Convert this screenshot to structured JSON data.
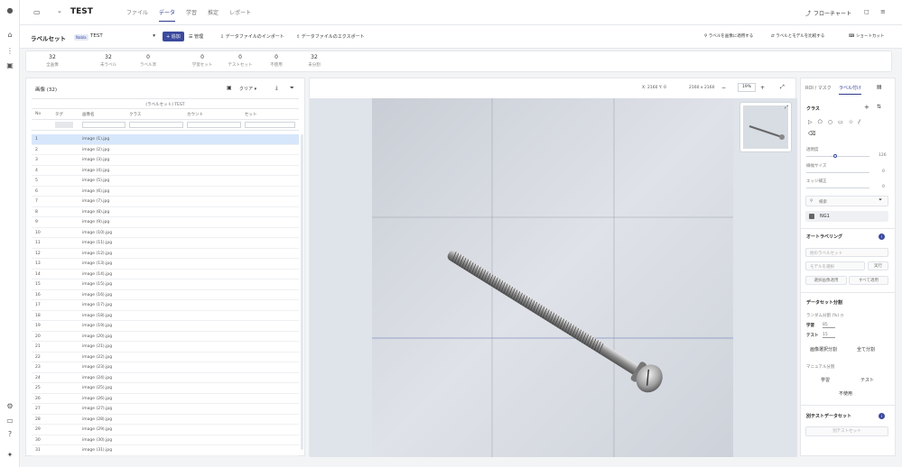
{
  "header": {
    "title": "TEST",
    "tabs": [
      {
        "label": "ファイル",
        "active": false
      },
      {
        "label": "データ",
        "active": true
      },
      {
        "label": "学習",
        "active": false
      },
      {
        "label": "推定",
        "active": false
      },
      {
        "label": "レポート",
        "active": false
      }
    ],
    "flowchart_label": "フローチャート"
  },
  "toolbar": {
    "labelset_label": "ラベルセット",
    "badge": "Nabla",
    "labelset_value": "TEST",
    "add_label": "+ 追加",
    "manage_label": "管理",
    "import_label": "データファイルのインポート",
    "export_label": "データファイルのエクスポート",
    "auto_label": "ラベルを画像に適用する",
    "compare_label": "ラベルとモデルを比較する",
    "shortcut_label": "ショートカット"
  },
  "stats": [
    {
      "value": "32",
      "label": "全画像"
    },
    {
      "value": "32",
      "label": "未ラベル"
    },
    {
      "value": "0",
      "label": "ラベル済"
    },
    {
      "value": "0",
      "label": "学習セット"
    },
    {
      "value": "0",
      "label": "テストセット"
    },
    {
      "value": "0",
      "label": "不使用"
    },
    {
      "value": "32",
      "label": "未分割"
    }
  ],
  "list": {
    "header": "画像 (32)",
    "clear_label": "クリア",
    "group_header": "(ラベルセット) TEST",
    "columns": [
      "No",
      "タグ",
      "画像名",
      "クラス",
      "カウント",
      "セット"
    ],
    "rows": [
      {
        "no": "1",
        "name": "image (1).jpg"
      },
      {
        "no": "2",
        "name": "image (2).jpg"
      },
      {
        "no": "3",
        "name": "image (3).jpg"
      },
      {
        "no": "4",
        "name": "image (4).jpg"
      },
      {
        "no": "5",
        "name": "image (5).jpg"
      },
      {
        "no": "6",
        "name": "image (6).jpg"
      },
      {
        "no": "7",
        "name": "image (7).jpg"
      },
      {
        "no": "8",
        "name": "image (8).jpg"
      },
      {
        "no": "9",
        "name": "image (9).jpg"
      },
      {
        "no": "10",
        "name": "image (10).jpg"
      },
      {
        "no": "11",
        "name": "image (11).jpg"
      },
      {
        "no": "12",
        "name": "image (12).jpg"
      },
      {
        "no": "13",
        "name": "image (13).jpg"
      },
      {
        "no": "14",
        "name": "image (14).jpg"
      },
      {
        "no": "15",
        "name": "image (15).jpg"
      },
      {
        "no": "16",
        "name": "image (16).jpg"
      },
      {
        "no": "17",
        "name": "image (17).jpg"
      },
      {
        "no": "18",
        "name": "image (18).jpg"
      },
      {
        "no": "19",
        "name": "image (19).jpg"
      },
      {
        "no": "20",
        "name": "image (20).jpg"
      },
      {
        "no": "21",
        "name": "image (21).jpg"
      },
      {
        "no": "22",
        "name": "image (22).jpg"
      },
      {
        "no": "23",
        "name": "image (23).jpg"
      },
      {
        "no": "24",
        "name": "image (24).jpg"
      },
      {
        "no": "25",
        "name": "image (25).jpg"
      },
      {
        "no": "26",
        "name": "image (26).jpg"
      },
      {
        "no": "27",
        "name": "image (27).jpg"
      },
      {
        "no": "28",
        "name": "image (28).jpg"
      },
      {
        "no": "29",
        "name": "image (29).jpg"
      },
      {
        "no": "30",
        "name": "image (30).jpg"
      },
      {
        "no": "31",
        "name": "image (31).jpg"
      }
    ]
  },
  "viewer": {
    "coords": "X: 2160  Y: 0",
    "size": "2160 x 2160",
    "zoom": "19%"
  },
  "right": {
    "tab_roi": "ROI / マスク",
    "tab_label": "ラベル付け",
    "class_title": "クラス",
    "opacity_label": "透明度",
    "opacity_value": "126",
    "brush_label": "線幅サイズ",
    "brush_value": "0",
    "edge_label": "エッジ補正",
    "edge_value": "0",
    "search_placeholder": "検索",
    "class_name": "NG1",
    "auto_title": "オートラベリング",
    "auto_select": "他のラベルセット",
    "auto_input": "モデルを選択",
    "auto_exec": "実行",
    "auto_btn1": "選択画像適用",
    "auto_btn2": "すべて適用",
    "split_title": "データセット分割",
    "split_random": "ランダム分割 (%)",
    "train_label": "学習",
    "train_value": "85",
    "test_label": "テスト",
    "test_value": "15",
    "split_btn1": "画像選択分割",
    "split_btn2": "全て分割",
    "manual_label": "マニュアル分割",
    "manual_train": "学習",
    "manual_test": "テスト",
    "manual_unused": "不使用",
    "testdata_title": "別テストデータセット",
    "testdata_btn": "別テストセット"
  },
  "colors": {
    "accent": "#3b4a9e",
    "selected_row": "#d7e7fb"
  }
}
